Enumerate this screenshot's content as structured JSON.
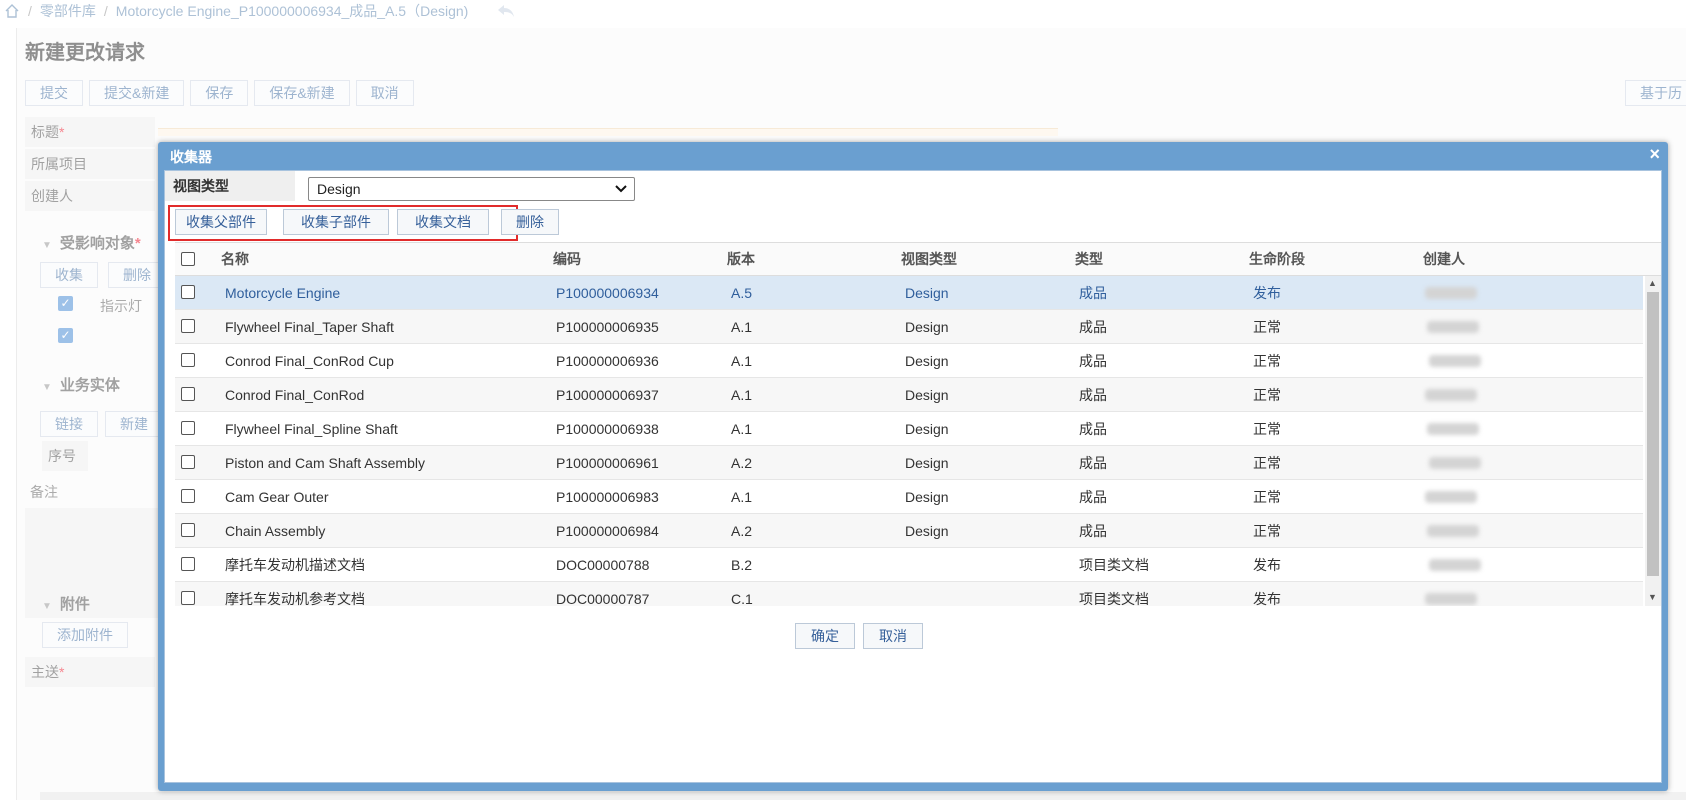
{
  "breadcrumb": {
    "items": [
      "零部件库",
      "Motorcycle Engine_P100000006934_成品_A.5（Design)"
    ]
  },
  "page": {
    "title": "新建更改请求",
    "toolbar": [
      "提交",
      "提交&新建",
      "保存",
      "保存&新建",
      "取消"
    ],
    "toolbar_right": "基于历",
    "fields": {
      "title": "标题",
      "project": "所属项目",
      "creator": "创建人",
      "remark": "备注",
      "recipient": "主送"
    },
    "sections": {
      "affected": "受影响对象",
      "business": "业务实体",
      "attachment": "附件"
    },
    "affected_buttons": [
      "收集",
      "删除"
    ],
    "affected_col": "指示灯",
    "business_buttons": [
      "链接",
      "新建"
    ],
    "business_col": "序号",
    "attachment_button": "添加附件"
  },
  "dialog": {
    "title": "收集器",
    "close": "×",
    "view_type_label": "视图类型",
    "view_type_value": "Design",
    "collect_buttons": [
      "收集父部件",
      "收集子部件",
      "收集文档"
    ],
    "delete_button": "删除",
    "columns": [
      "名称",
      "编码",
      "版本",
      "视图类型",
      "类型",
      "生命阶段",
      "创建人"
    ],
    "rows": [
      {
        "name": "Motorcycle Engine",
        "code": "P100000006934",
        "version": "A.5",
        "view": "Design",
        "type": "成品",
        "stage": "发布",
        "selected": true
      },
      {
        "name": "Flywheel Final_Taper Shaft",
        "code": "P100000006935",
        "version": "A.1",
        "view": "Design",
        "type": "成品",
        "stage": "正常",
        "selected": false
      },
      {
        "name": "Conrod Final_ConRod Cup",
        "code": "P100000006936",
        "version": "A.1",
        "view": "Design",
        "type": "成品",
        "stage": "正常",
        "selected": false
      },
      {
        "name": "Conrod Final_ConRod",
        "code": "P100000006937",
        "version": "A.1",
        "view": "Design",
        "type": "成品",
        "stage": "正常",
        "selected": false
      },
      {
        "name": "Flywheel Final_Spline Shaft",
        "code": "P100000006938",
        "version": "A.1",
        "view": "Design",
        "type": "成品",
        "stage": "正常",
        "selected": false
      },
      {
        "name": "Piston and Cam Shaft Assembly",
        "code": "P100000006961",
        "version": "A.2",
        "view": "Design",
        "type": "成品",
        "stage": "正常",
        "selected": false
      },
      {
        "name": "Cam Gear Outer",
        "code": "P100000006983",
        "version": "A.1",
        "view": "Design",
        "type": "成品",
        "stage": "正常",
        "selected": false
      },
      {
        "name": "Chain Assembly",
        "code": "P100000006984",
        "version": "A.2",
        "view": "Design",
        "type": "成品",
        "stage": "正常",
        "selected": false
      },
      {
        "name": "摩托车发动机描述文档",
        "code": "DOC00000788",
        "version": "B.2",
        "view": "",
        "type": "项目类文档",
        "stage": "发布",
        "selected": false
      },
      {
        "name": "摩托车发动机参考文档",
        "code": "DOC00000787",
        "version": "C.1",
        "view": "",
        "type": "项目类文档",
        "stage": "发布",
        "selected": false
      }
    ],
    "ok_button": "确定",
    "cancel_button": "取消"
  },
  "colors": {
    "dialog_header": "#6a9fd0",
    "link_blue": "#36609a",
    "highlight_red": "#e12b2b",
    "selected_row": "#dbe8f5"
  }
}
